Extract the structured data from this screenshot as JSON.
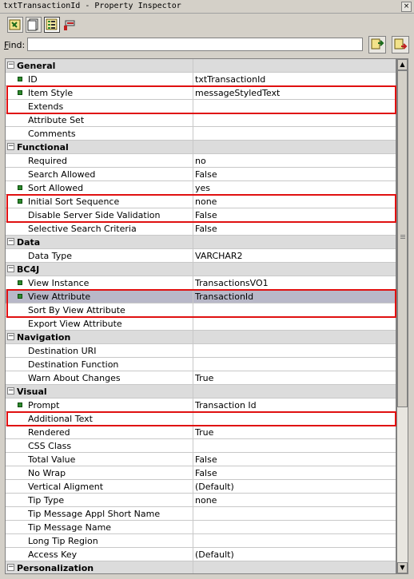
{
  "window": {
    "title": "txtTransactionId - Property Inspector"
  },
  "find": {
    "label_prefix": "",
    "label_underlined": "F",
    "label_rest": "ind:",
    "value": ""
  },
  "rows": [
    {
      "type": "cat",
      "label": "General"
    },
    {
      "type": "prop",
      "label": "ID",
      "value": "txtTransactionId",
      "marked": true
    },
    {
      "type": "prop",
      "label": "Item Style",
      "value": "messageStyledText",
      "marked": true
    },
    {
      "type": "prop",
      "label": "Extends",
      "value": ""
    },
    {
      "type": "prop",
      "label": "Attribute Set",
      "value": ""
    },
    {
      "type": "prop",
      "label": "Comments",
      "value": ""
    },
    {
      "type": "cat",
      "label": "Functional"
    },
    {
      "type": "prop",
      "label": "Required",
      "value": "no"
    },
    {
      "type": "prop",
      "label": "Search Allowed",
      "value": "False"
    },
    {
      "type": "prop",
      "label": "Sort Allowed",
      "value": "yes",
      "marked": true
    },
    {
      "type": "prop",
      "label": "Initial Sort Sequence",
      "value": "none",
      "marked": true
    },
    {
      "type": "prop",
      "label": "Disable Server Side Validation",
      "value": "False"
    },
    {
      "type": "prop",
      "label": "Selective Search Criteria",
      "value": "False"
    },
    {
      "type": "cat",
      "label": "Data"
    },
    {
      "type": "prop",
      "label": "Data Type",
      "value": "VARCHAR2"
    },
    {
      "type": "cat",
      "label": "BC4J"
    },
    {
      "type": "prop",
      "label": "View Instance",
      "value": "TransactionsVO1",
      "marked": true
    },
    {
      "type": "prop",
      "label": "View Attribute",
      "value": "TransactionId",
      "marked": true,
      "selected": true
    },
    {
      "type": "prop",
      "label": "Sort By View Attribute",
      "value": ""
    },
    {
      "type": "prop",
      "label": "Export View Attribute",
      "value": ""
    },
    {
      "type": "cat",
      "label": "Navigation"
    },
    {
      "type": "prop",
      "label": "Destination URI",
      "value": ""
    },
    {
      "type": "prop",
      "label": "Destination Function",
      "value": ""
    },
    {
      "type": "prop",
      "label": "Warn About Changes",
      "value": "True"
    },
    {
      "type": "cat",
      "label": "Visual"
    },
    {
      "type": "prop",
      "label": "Prompt",
      "value": "Transaction Id",
      "marked": true
    },
    {
      "type": "prop",
      "label": "Additional Text",
      "value": ""
    },
    {
      "type": "prop",
      "label": "Rendered",
      "value": "True"
    },
    {
      "type": "prop",
      "label": "CSS Class",
      "value": ""
    },
    {
      "type": "prop",
      "label": "Total Value",
      "value": "False"
    },
    {
      "type": "prop",
      "label": "No Wrap",
      "value": "False"
    },
    {
      "type": "prop",
      "label": "Vertical Aligment",
      "value": "(Default)"
    },
    {
      "type": "prop",
      "label": "Tip Type",
      "value": "none"
    },
    {
      "type": "prop",
      "label": "Tip Message Appl Short Name",
      "value": ""
    },
    {
      "type": "prop",
      "label": "Tip Message Name",
      "value": ""
    },
    {
      "type": "prop",
      "label": "Long Tip Region",
      "value": ""
    },
    {
      "type": "prop",
      "label": "Access Key",
      "value": "(Default)"
    },
    {
      "type": "cat",
      "label": "Personalization"
    }
  ],
  "colors": {
    "highlight": "#e01010",
    "marker": "#2e8b2e",
    "category_bg": "#dcdcdc",
    "selected_bg": "#b8b8c8"
  },
  "icons": {
    "toolbar": [
      "connect-icon",
      "new-page-icon",
      "list-view-icon",
      "pin-icon"
    ],
    "find": [
      "find-previous-icon",
      "find-next-icon"
    ]
  }
}
